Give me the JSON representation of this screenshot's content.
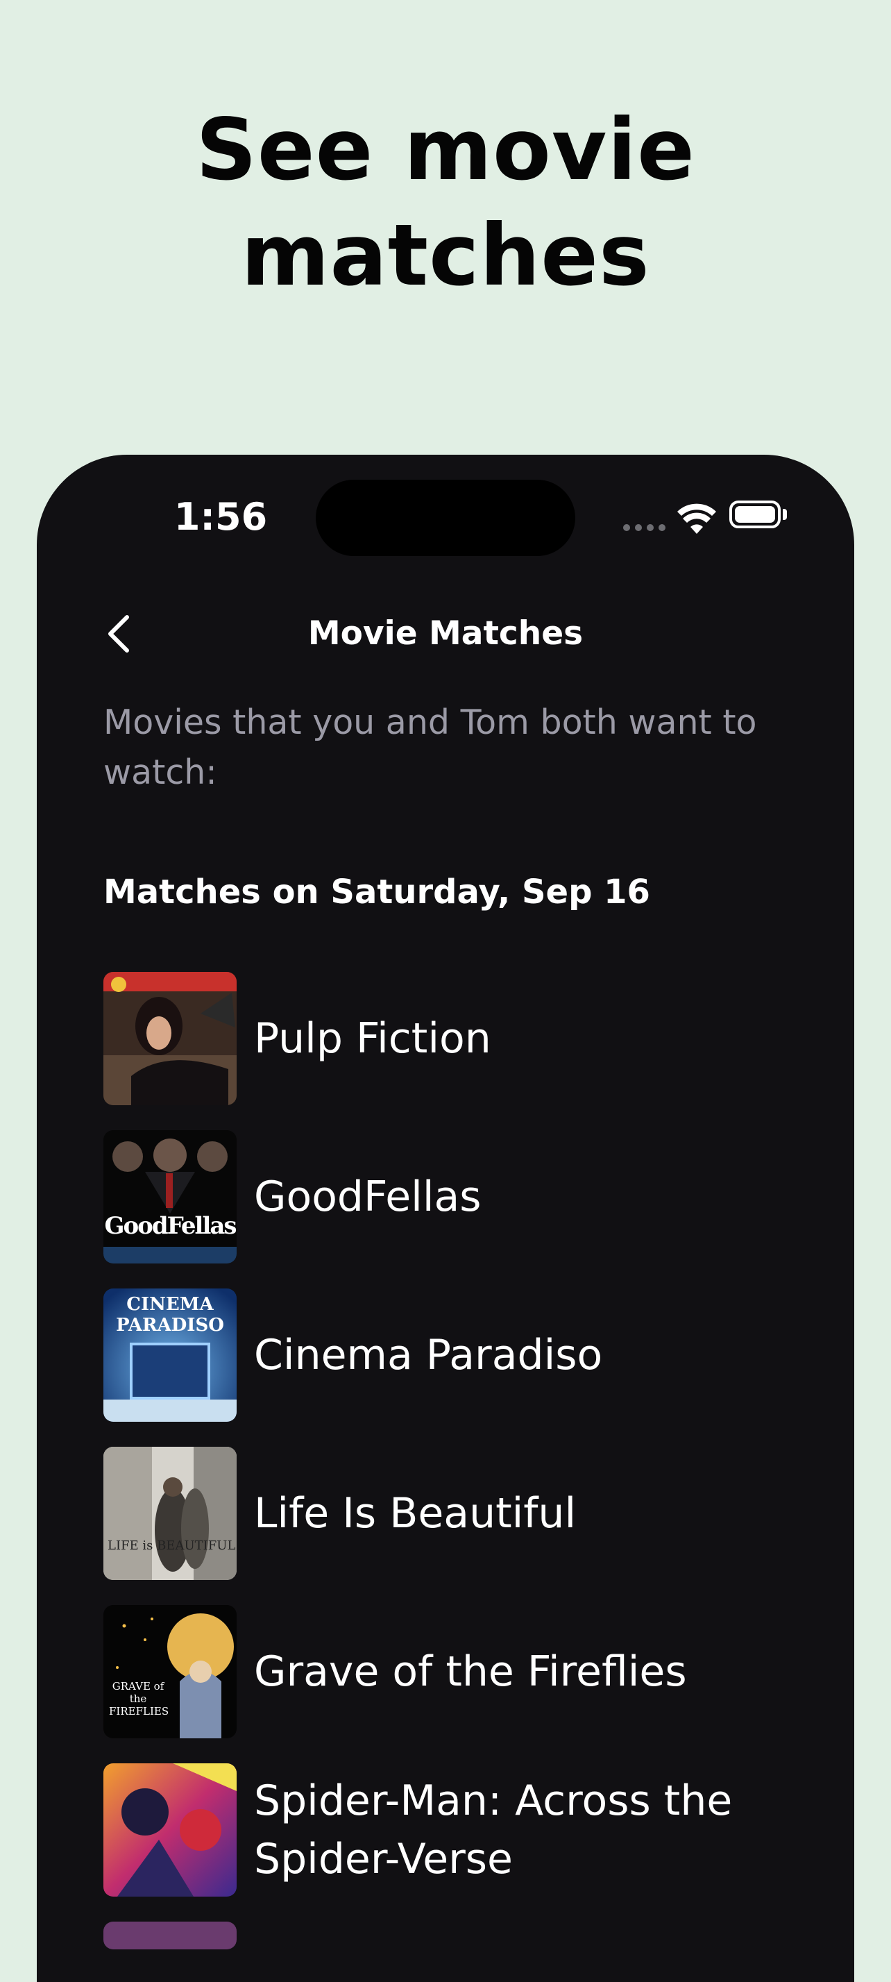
{
  "headline": "See movie matches",
  "status_bar": {
    "time": "1:56"
  },
  "header": {
    "title": "Movie Matches",
    "back_icon": "chevron-left-icon"
  },
  "subtitle": "Movies that you and Tom both want to watch:",
  "section_title": "Matches on Saturday, Sep 16",
  "movies": [
    {
      "title": "Pulp Fiction",
      "poster": "pulp-fiction-poster"
    },
    {
      "title": "GoodFellas",
      "poster": "goodfellas-poster",
      "poster_text": "GoodFellas"
    },
    {
      "title": "Cinema Paradiso",
      "poster": "cinema-paradiso-poster",
      "poster_text": "CINEMA PARADISO"
    },
    {
      "title": "Life Is Beautiful",
      "poster": "life-is-beautiful-poster",
      "poster_text": "LIFE is BEAUTIFUL"
    },
    {
      "title": "Grave of the Fireflies",
      "poster": "grave-of-the-fireflies-poster",
      "poster_text": "GRAVE of the FIREFLIES"
    },
    {
      "title": "Spider-Man: Across the Spider-Verse",
      "poster": "spider-verse-poster"
    }
  ]
}
